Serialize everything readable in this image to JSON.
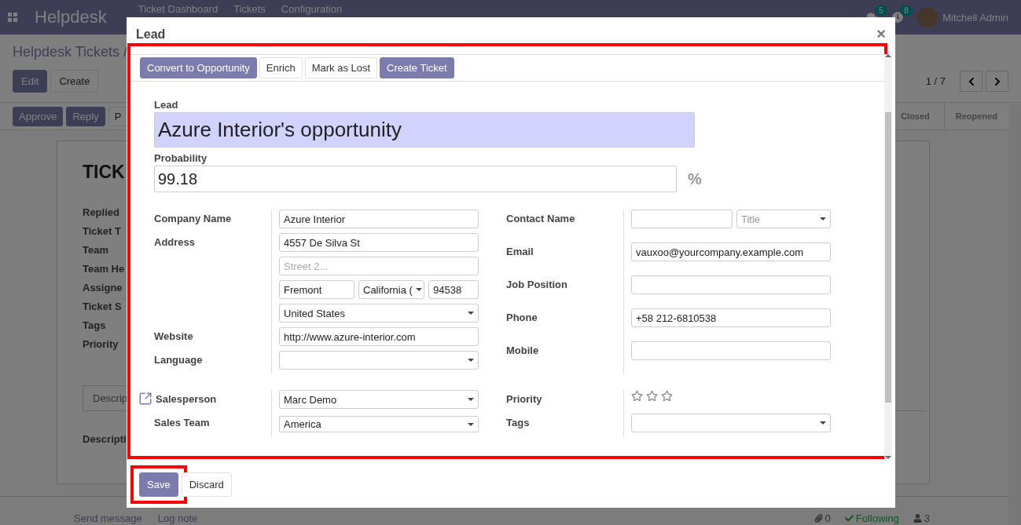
{
  "navbar": {
    "app_name": "Helpdesk",
    "menu": [
      "Ticket Dashboard",
      "Tickets",
      "Configuration"
    ],
    "messages_count": "5",
    "activities_count": "8",
    "user": "Mitchell Admin"
  },
  "control_panel": {
    "breadcrumb": "Helpdesk Tickets /",
    "buttons": [
      {
        "label": "Edit",
        "kind": "primary"
      },
      {
        "label": "Create",
        "kind": "secondary"
      }
    ],
    "pager": "1 / 7"
  },
  "statusbar": {
    "buttons": [
      {
        "label": "Approve",
        "kind": "primary"
      },
      {
        "label": "Reply",
        "kind": "primary"
      },
      {
        "label": "P",
        "kind": "secondary"
      }
    ],
    "stages": [
      "Closed",
      "Reopened"
    ]
  },
  "sheet": {
    "title": "TICK",
    "fields": [
      "Replied",
      "Ticket T",
      "Team",
      "Team He",
      "Assigne",
      "Ticket S",
      "Tags",
      "Priority"
    ],
    "tab": "Descrip",
    "section_label": "Descripti"
  },
  "chatter": {
    "send_message": "Send message",
    "log_note": "Log note",
    "attachments": "0",
    "follow": "Following",
    "followers": "3"
  },
  "dialog": {
    "title": "Lead",
    "close": "×",
    "buttons": [
      {
        "label": "Convert to Opportunity",
        "kind": "primary"
      },
      {
        "label": "Enrich",
        "kind": "secondary"
      },
      {
        "label": "Mark as Lost",
        "kind": "secondary"
      },
      {
        "label": "Create Ticket",
        "kind": "primary"
      }
    ],
    "name_label": "Lead",
    "name": "Azure Interior's opportunity",
    "probability_label": "Probability",
    "probability": "99.18",
    "percent": "%",
    "sections": [
      {
        "left": [
          {
            "label": "Company Name",
            "lines": [
              [
                {
                  "kind": "text",
                  "value": "Azure Interior"
                }
              ]
            ]
          },
          {
            "label": "Address",
            "lines": [
              [
                {
                  "kind": "text",
                  "value": "4557 De Silva St"
                }
              ],
              [
                {
                  "kind": "text",
                  "placeholder": "Street 2..."
                }
              ],
              [
                {
                  "kind": "text",
                  "value": "Fremont"
                },
                {
                  "kind": "select",
                  "value": "California ("
                },
                {
                  "kind": "text",
                  "value": "94538"
                }
              ],
              [
                {
                  "kind": "select",
                  "value": "United States"
                }
              ]
            ]
          },
          {
            "label": "Website",
            "lines": [
              [
                {
                  "kind": "text",
                  "value": "http://www.azure-interior.com"
                }
              ]
            ]
          },
          {
            "label": "Language",
            "lines": [
              [
                {
                  "kind": "select"
                }
              ]
            ]
          }
        ],
        "right": [
          {
            "label": "Contact Name",
            "lines": [
              [
                {
                  "kind": "text"
                },
                {
                  "kind": "select",
                  "placeholder": "Title"
                }
              ]
            ]
          },
          {
            "label": "Email",
            "lines": [
              [
                {
                  "kind": "text",
                  "value": "vauxoo@yourcompany.example.com"
                }
              ]
            ]
          },
          {
            "label": "Job Position",
            "lines": [
              [
                {
                  "kind": "text"
                }
              ]
            ]
          },
          {
            "label": "Phone",
            "lines": [
              [
                {
                  "kind": "text",
                  "value": "+58 212-6810538"
                }
              ]
            ]
          },
          {
            "label": "Mobile",
            "lines": [
              [
                {
                  "kind": "text"
                }
              ]
            ]
          }
        ]
      },
      {
        "left": [
          {
            "label": "Salesperson",
            "external_link": true,
            "lines": [
              [
                {
                  "kind": "select",
                  "value": "Marc Demo"
                }
              ]
            ]
          },
          {
            "label": "Sales Team",
            "lines": [
              [
                {
                  "kind": "native_select",
                  "value": "America"
                }
              ]
            ]
          }
        ],
        "right": [
          {
            "label": "Priority",
            "lines": [
              [
                {
                  "kind": "stars",
                  "stars": 0
                }
              ]
            ]
          },
          {
            "label": "Tags",
            "lines": [
              [
                {
                  "kind": "select"
                }
              ]
            ]
          }
        ]
      }
    ],
    "footer_buttons": [
      {
        "label": "Save",
        "kind": "primary",
        "highlighted": true
      },
      {
        "label": "Discard",
        "kind": "secondary",
        "highlighted": false
      }
    ],
    "body_highlighted": true
  }
}
